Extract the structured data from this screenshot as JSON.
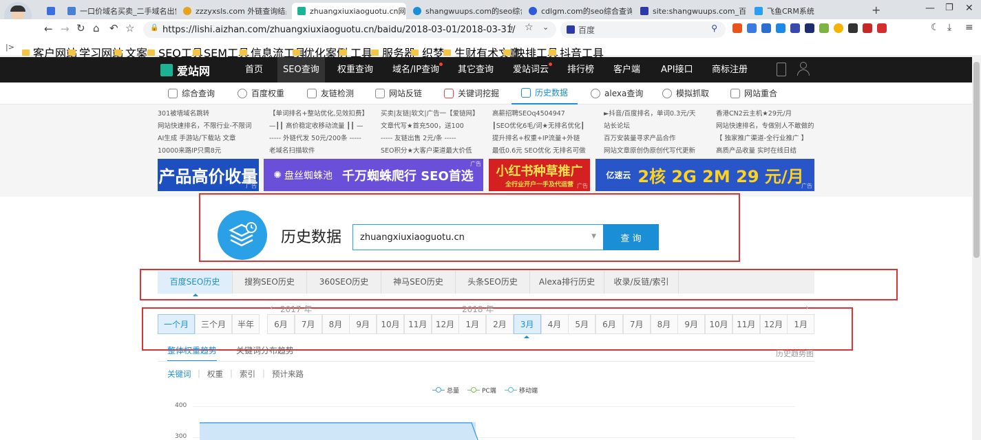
{
  "browser": {
    "tabs": [
      {
        "label": "一口价域名买卖_二手域名出售 -"
      },
      {
        "label": "zzzyxsls.com 外链查询结果 -"
      },
      {
        "label": "zhuangxiuxiaoguotu.cn网"
      },
      {
        "label": "shangwuups.com的seo综合"
      },
      {
        "label": "cdlgm.com的seo综合查询 - "
      },
      {
        "label": "site:shangwuups.com_百度搜"
      },
      {
        "label": "飞鱼CRM系统"
      }
    ],
    "url": "https://lishi.aizhan.com/zhuangxiuxiaoguotu.cn/baidu/2018-03-01/2018-03-31/",
    "search_engine": "百度",
    "bookmarks": [
      "客户网站",
      "学习网站",
      "文案",
      "SEO工具",
      "SEM工具",
      "信息流工具",
      "优化案例",
      "工具",
      "服务器",
      "织梦",
      "生财有术文章",
      "快排工具",
      "抖音工具"
    ]
  },
  "site": {
    "logo_text": "爱站网",
    "nav": [
      "首页",
      "SEO查询",
      "权重查询",
      "域名/IP查询",
      "其它查询",
      "爱站词云",
      "排行榜",
      "客户端",
      "API接口",
      "商标注册"
    ],
    "subnav": [
      "综合查询",
      "百度权重",
      "友链检测",
      "网站反链",
      "关键词挖掘",
      "历史数据",
      "alexa查询",
      "模拟抓取",
      "网站重合"
    ]
  },
  "ads": {
    "text_columns": [
      [
        "301被墙域名跳转",
        "网站快速排名，不限行业-不限词",
        "AI生成 手游站/下载站 文章",
        "10000来路IP只需8元"
      ],
      [
        "【单词排名+整站优化,见效扣费】",
        "—┃┃ 高价稳定收移动流量 ┃┃ —",
        "----- 外链代发 50元/200条 -----",
        "老域名扫描软件"
      ],
      [
        "买卖|友链|软文|广告一【爱链网】",
        "文章代写★首充500，送100",
        "----- 友链出售 2元/条 -----",
        "SEO积分★大客户渠道最大价低"
      ],
      [
        "高薪招聘SEOq4504947",
        "┃SEO优化6毛/词★无排名优化┃",
        "提升排名+权重+IP流量+外链",
        "最低0.6元 SEO优化 无排名可做"
      ],
      [
        "►抖音/百度排名，单词0.3元/天",
        "站长论坛",
        "百万安装量寻求产品合作",
        "网站文章原创伪原创代写代更新"
      ],
      [
        "香港CN2云主机★29元/月",
        "网站快速排名，专做别人不敢做的",
        "【 独家推广渠道-全行业推广 】",
        "高质产品收量 实时在线日结"
      ]
    ],
    "banners": [
      {
        "text": "产品高价收量",
        "tag": "广告"
      },
      {
        "text": "千万蜘蛛爬行 SEO首选",
        "sub": "盘丝蜘蛛池",
        "tag": "广告"
      },
      {
        "text": "小红书种草推广",
        "sub": "全行业开户一手及代运营",
        "tag": "广告"
      },
      {
        "text": "2核 2G 2M 29 元/月",
        "sub": "亿速云",
        "tag": "广告"
      }
    ]
  },
  "query": {
    "title": "历史数据",
    "domain": "zhuangxiuxiaoguotu.cn",
    "button": "查 询"
  },
  "history_tabs": [
    "百度SEO历史",
    "搜狗SEO历史",
    "360SEO历史",
    "神马SEO历史",
    "头条SEO历史",
    "Alexa排行历史",
    "收录/反链/索引"
  ],
  "periods": [
    "一个月",
    "三个月",
    "半年"
  ],
  "years": [
    "2017 年",
    "2018 年"
  ],
  "months": [
    "6月",
    "7月",
    "8月",
    "9月",
    "10月",
    "11月",
    "12月",
    "1月",
    "2月",
    "3月",
    "4月",
    "5月",
    "6月",
    "7月",
    "8月",
    "9月",
    "10月",
    "11月",
    "12月",
    "1月"
  ],
  "selected_month_index": 9,
  "trend_tabs": [
    "整体权重趋势",
    "关键词分布趋势"
  ],
  "trend_right": "历史趋势图",
  "metric_tabs": [
    "关键词",
    "权重",
    "索引",
    "预计来路"
  ],
  "legend": [
    "总量",
    "PC端",
    "移动端"
  ],
  "colors": {
    "accent": "#1a8fd6",
    "nav_bg": "#1a1a1a",
    "highlight_box": "#d33333"
  },
  "chart_data": {
    "type": "line",
    "y_ticks": [
      400,
      300
    ],
    "series": [
      {
        "name": "总量",
        "values": []
      },
      {
        "name": "PC端",
        "values": []
      },
      {
        "name": "移动端",
        "values": []
      }
    ]
  }
}
